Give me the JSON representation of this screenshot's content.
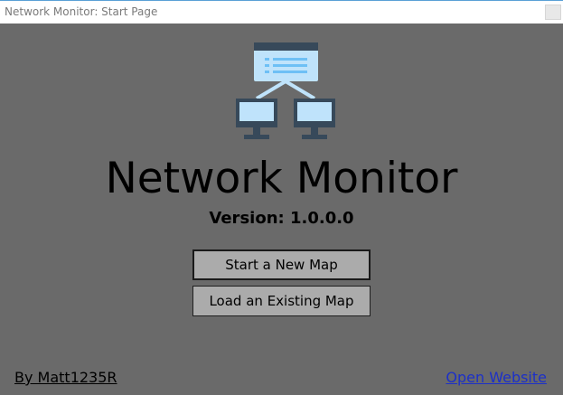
{
  "window": {
    "title": "Network Monitor: Start Page"
  },
  "main": {
    "app_name": "Network Monitor",
    "version_text": "Version: 1.0.0.0",
    "logo_icon": "network-topology-icon",
    "buttons": {
      "new_map": "Start a New Map",
      "load_map": "Load an Existing Map"
    }
  },
  "footer": {
    "author_link": "By Matt1235R",
    "website_link": "Open Website"
  },
  "colors": {
    "background": "#6a6a6a",
    "button_fill": "#ababab",
    "link_blue": "#1c30c8",
    "logo_light": "#bfe3fb",
    "logo_mid": "#6ec0f5",
    "logo_dark": "#37495a"
  }
}
